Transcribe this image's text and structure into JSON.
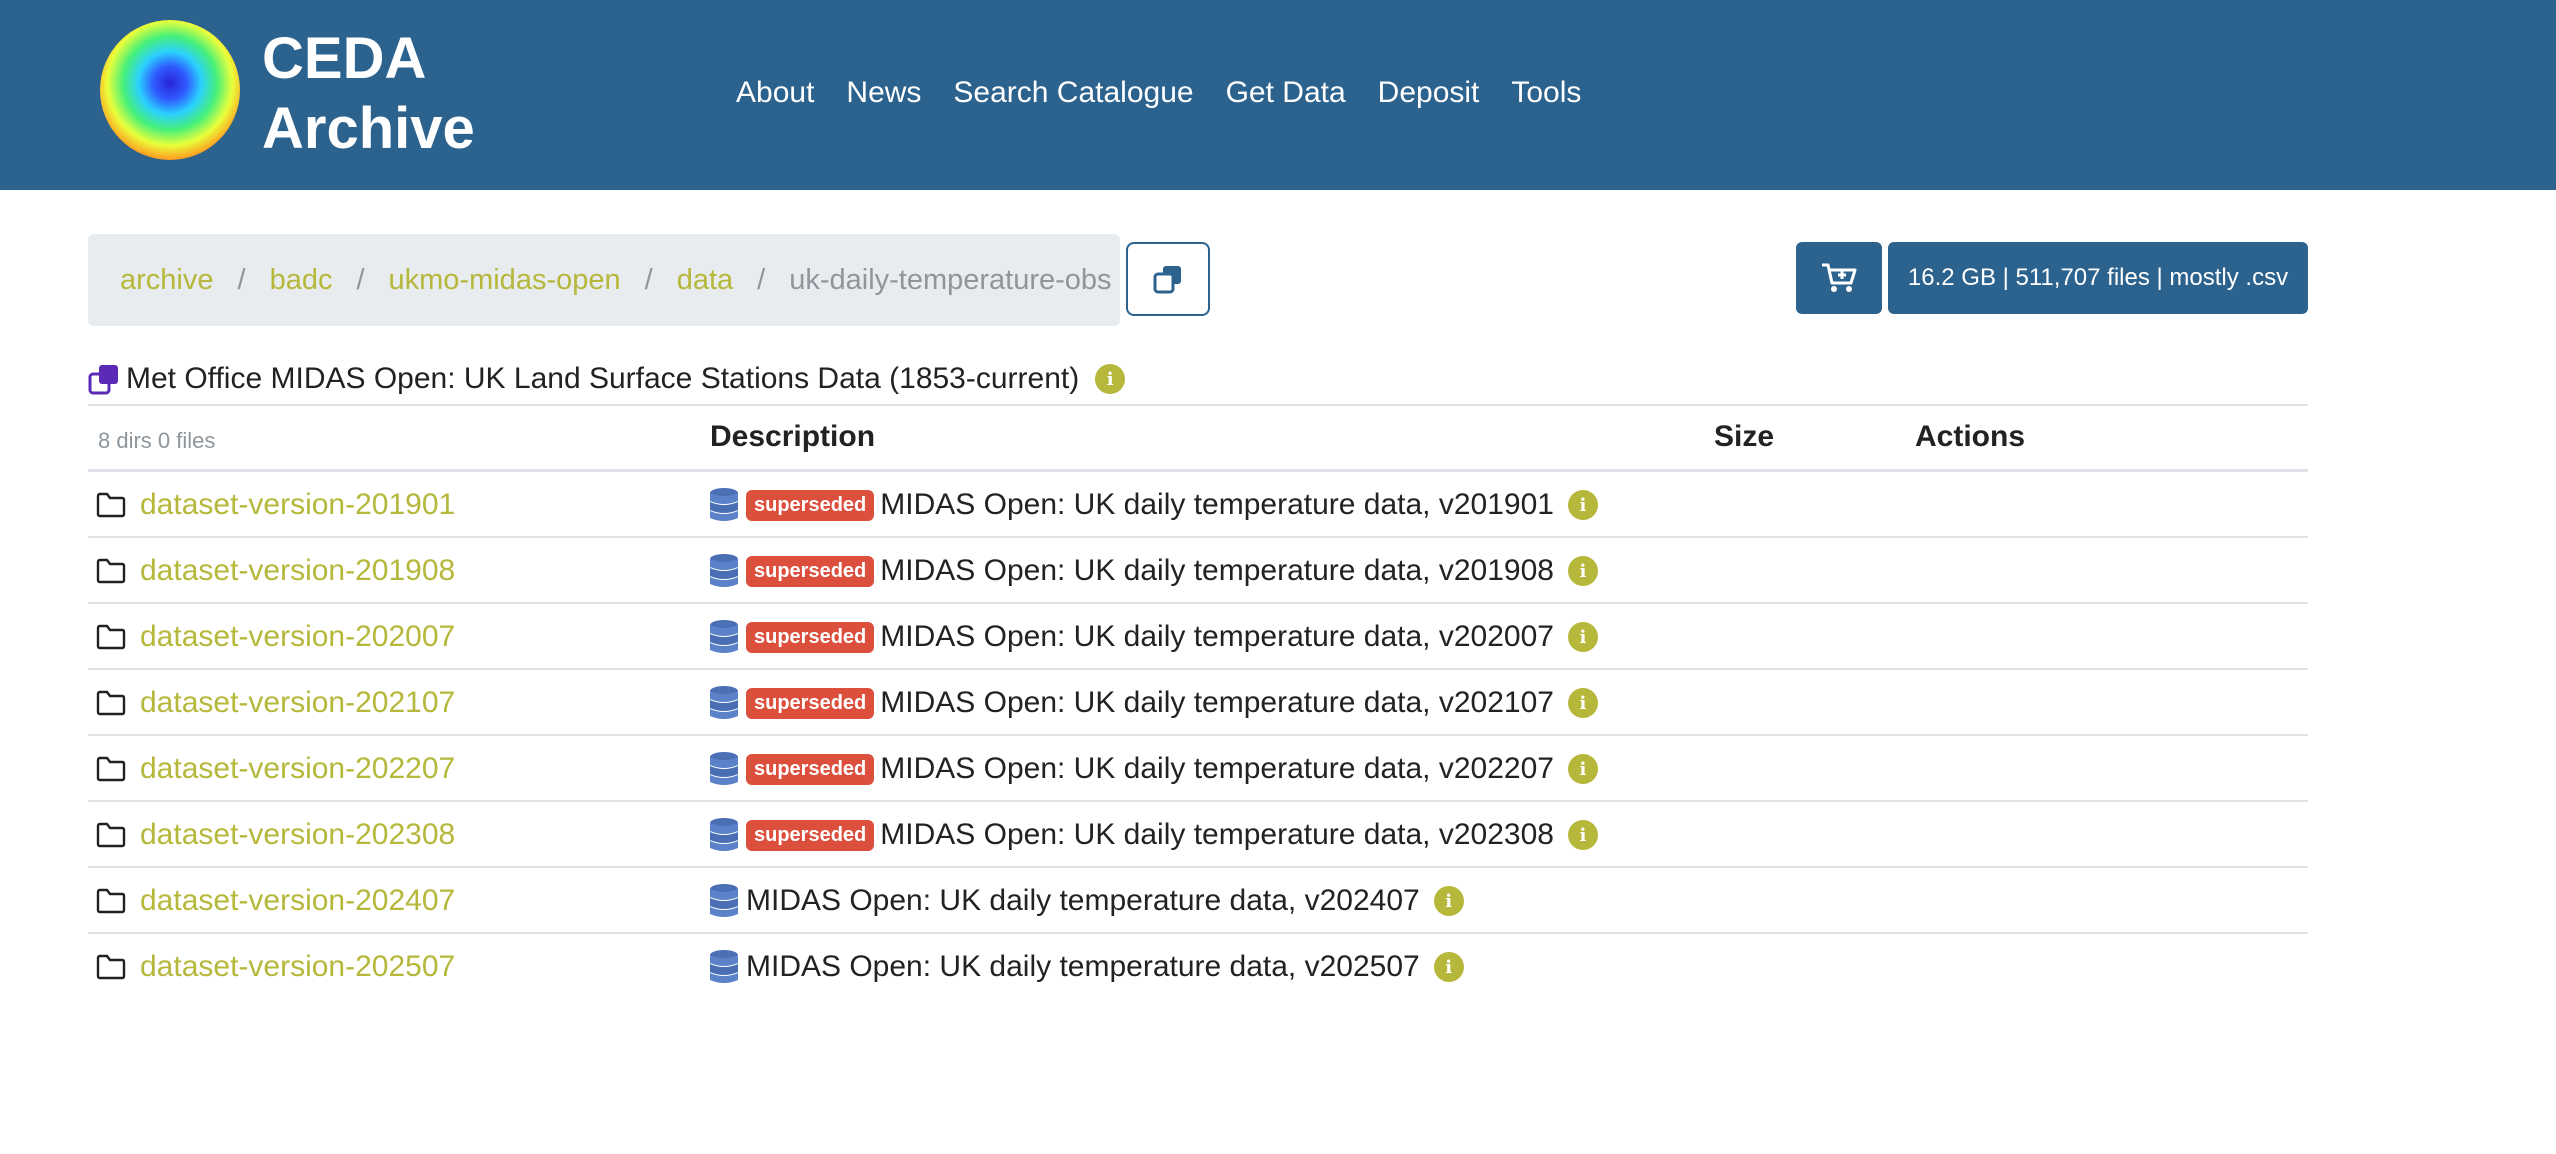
{
  "header": {
    "logo_line1": "CEDA",
    "logo_line2": "Archive",
    "nav": [
      "About",
      "News",
      "Search Catalogue",
      "Get Data",
      "Deposit",
      "Tools"
    ]
  },
  "breadcrumb": [
    "archive",
    "badc",
    "ukmo-midas-open",
    "data",
    "uk-daily-temperature-obs"
  ],
  "stats": "16.2 GB | 511,707 files | mostly .csv",
  "dataset_title": "Met Office MIDAS Open: UK Land Surface Stations Data (1853-current)",
  "table": {
    "summary": "8 dirs 0 files",
    "headers": {
      "description": "Description",
      "size": "Size",
      "actions": "Actions"
    },
    "badge_label": "superseded",
    "rows": [
      {
        "name": "dataset-version-201901",
        "description": "MIDAS Open: UK daily temperature data, v201901",
        "superseded": true
      },
      {
        "name": "dataset-version-201908",
        "description": "MIDAS Open: UK daily temperature data, v201908",
        "superseded": true
      },
      {
        "name": "dataset-version-202007",
        "description": "MIDAS Open: UK daily temperature data, v202007",
        "superseded": true
      },
      {
        "name": "dataset-version-202107",
        "description": "MIDAS Open: UK daily temperature data, v202107",
        "superseded": true
      },
      {
        "name": "dataset-version-202207",
        "description": "MIDAS Open: UK daily temperature data, v202207",
        "superseded": true
      },
      {
        "name": "dataset-version-202308",
        "description": "MIDAS Open: UK daily temperature data, v202308",
        "superseded": true
      },
      {
        "name": "dataset-version-202407",
        "description": "MIDAS Open: UK daily temperature data, v202407",
        "superseded": false
      },
      {
        "name": "dataset-version-202507",
        "description": "MIDAS Open: UK daily temperature data, v202507",
        "superseded": false
      }
    ]
  },
  "colors": {
    "header_bg": "#2c628e",
    "link": "#b5b83a",
    "badge": "#dc4f3c"
  }
}
